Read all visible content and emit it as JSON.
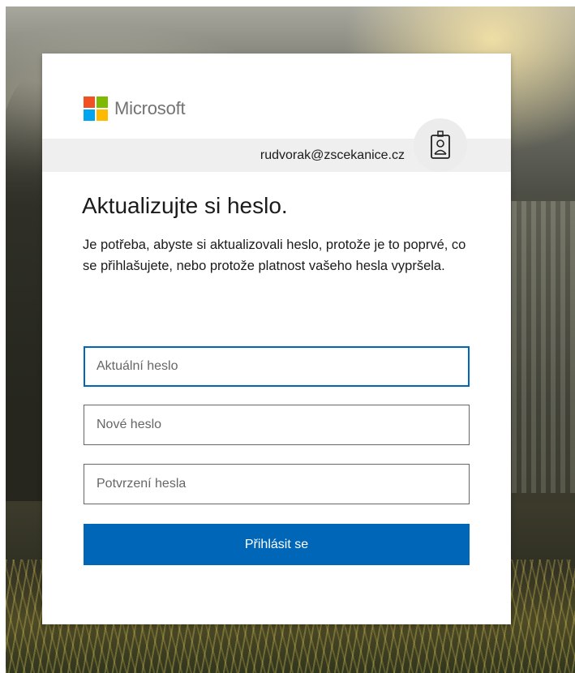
{
  "brand": {
    "name": "Microsoft",
    "colors": {
      "red": "#f25022",
      "green": "#7fba00",
      "blue": "#00a4ef",
      "yellow": "#ffb900",
      "accent": "#0067b8"
    }
  },
  "identity": {
    "email": "rudvorak@zscekanice.cz",
    "icon": "badge-icon"
  },
  "form": {
    "heading": "Aktualizujte si heslo.",
    "description": "Je potřeba, abyste si aktualizovali heslo, protože je to poprvé, co se přihlašujete, nebo protože platnost vašeho hesla vypršela.",
    "current_password": {
      "placeholder": "Aktuální heslo",
      "value": ""
    },
    "new_password": {
      "placeholder": "Nové heslo",
      "value": ""
    },
    "confirm_password": {
      "placeholder": "Potvrzení hesla",
      "value": ""
    },
    "submit_label": "Přihlásit se"
  }
}
